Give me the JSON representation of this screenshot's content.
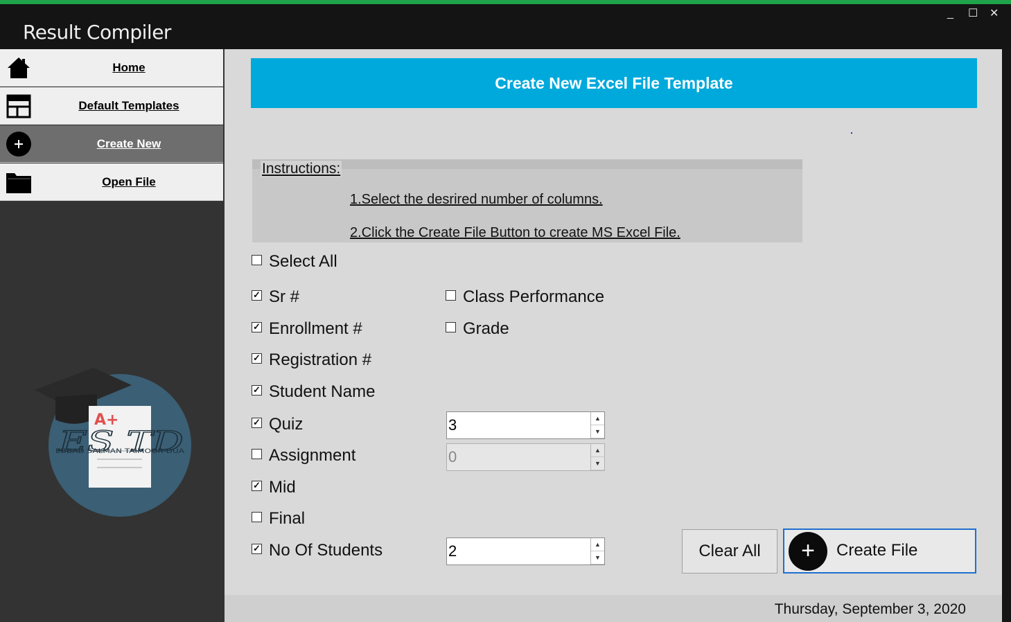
{
  "window": {
    "title": "Result Compiler",
    "controls": {
      "minimize": "_",
      "maximize": "☐",
      "close": "✕"
    }
  },
  "sidebar": {
    "items": [
      {
        "label": "Home",
        "icon": "home-icon",
        "active": false
      },
      {
        "label": "Default Templates",
        "icon": "template-icon",
        "active": false
      },
      {
        "label": "Create New",
        "icon": "plus-circle-icon",
        "active": true
      },
      {
        "label": "Open File",
        "icon": "folder-icon",
        "active": false
      }
    ],
    "logo": {
      "mark": "ES TD",
      "subtitle": "EBBAD SALMAN TAIMOOR DUA",
      "grade": "A+"
    }
  },
  "main": {
    "header": "Create New Excel File Template",
    "instructions": {
      "title": "Instructions:",
      "line1": "1.Select the desrired number of columns.",
      "line2": "2.Click the Create File Button to create MS Excel File."
    },
    "select_all": {
      "label": "Select All",
      "checked": false
    },
    "columns": [
      {
        "label": "Sr #",
        "checked": true
      },
      {
        "label": "Enrollment #",
        "checked": true
      },
      {
        "label": "Registration #",
        "checked": true
      },
      {
        "label": "Student Name",
        "checked": true
      },
      {
        "label": "Quiz",
        "checked": true
      },
      {
        "label": "Assignment",
        "checked": false
      },
      {
        "label": "Mid",
        "checked": true
      },
      {
        "label": "Final",
        "checked": false
      },
      {
        "label": "No Of Students",
        "checked": true
      }
    ],
    "extra_columns": [
      {
        "label": "Class Performance",
        "checked": false
      },
      {
        "label": "Grade",
        "checked": false
      }
    ],
    "quiz_count": "3",
    "assignment_count": "0",
    "student_count": "2",
    "clear_all_label": "Clear All",
    "create_file_label": "Create File",
    "create_file_icon": "+"
  },
  "footer": {
    "date": "Thursday, September 3, 2020"
  },
  "colors": {
    "accent": "#00a9dc",
    "top_bar": "#1fa34a",
    "focus_border": "#1f6fcf"
  }
}
